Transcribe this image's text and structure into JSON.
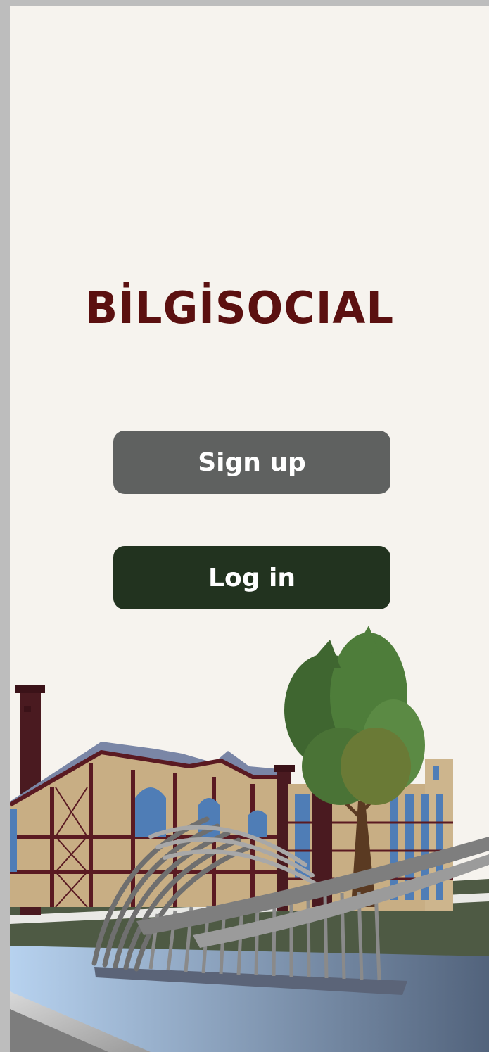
{
  "app": {
    "title": "BİLGİSOCIAL"
  },
  "actions": {
    "signup_label": "Sign up",
    "login_label": "Log in"
  },
  "colors": {
    "brand": "#5b1010",
    "signup_bg": "#5f6160",
    "login_bg": "#22331f",
    "background": "#f6f3ee"
  },
  "illustration": {
    "name": "campus-scene-illustration"
  }
}
